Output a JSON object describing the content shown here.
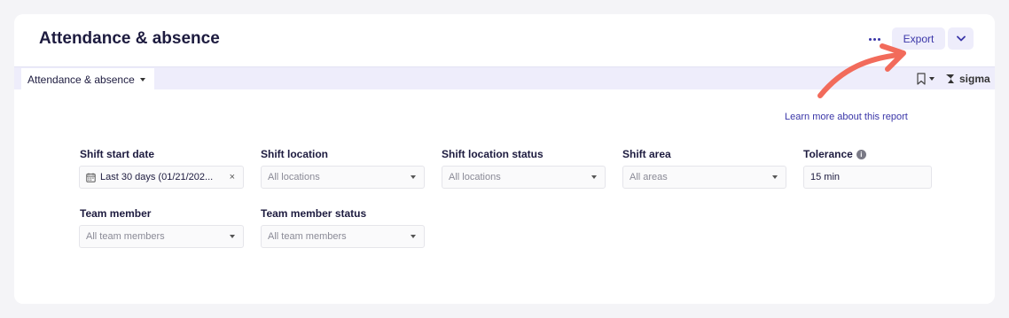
{
  "header": {
    "title": "Attendance & absence",
    "export_label": "Export"
  },
  "toolbar": {
    "tab_label": "Attendance & absence",
    "brand": "sigma"
  },
  "learn_more": "Learn more about this report",
  "filters": {
    "shift_start_date": {
      "label": "Shift start date",
      "value": "Last 30 days (01/21/202..."
    },
    "shift_location": {
      "label": "Shift location",
      "placeholder": "All locations"
    },
    "shift_location_status": {
      "label": "Shift location status",
      "placeholder": "All locations"
    },
    "shift_area": {
      "label": "Shift area",
      "placeholder": "All areas"
    },
    "tolerance": {
      "label": "Tolerance",
      "value": "15 min"
    },
    "team_member": {
      "label": "Team member",
      "placeholder": "All team members"
    },
    "team_member_status": {
      "label": "Team member status",
      "placeholder": "All team members"
    }
  },
  "icons": [
    "more-icon",
    "chevron-down-icon",
    "bookmark-icon",
    "sigma-logo-icon",
    "calendar-icon",
    "clear-icon",
    "info-icon",
    "arrow-annotation-icon"
  ],
  "colors": {
    "accent": "#3a36a8",
    "annotation": "#f26b5b",
    "toolbar_bg": "#eeedfb"
  }
}
